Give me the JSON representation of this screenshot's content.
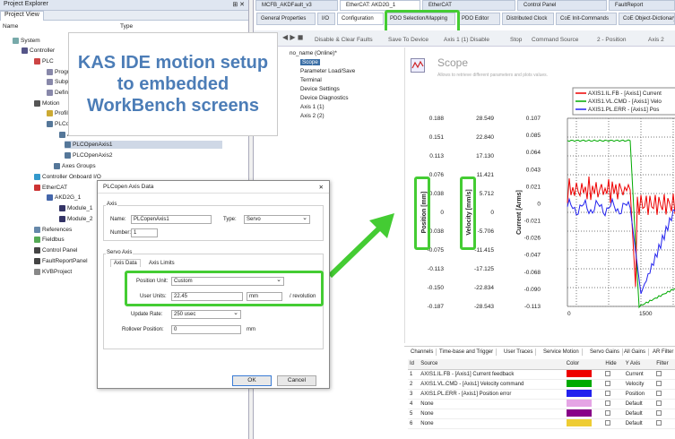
{
  "left_panel": {
    "title": "Project Explorer",
    "tab": "Project View",
    "col_name": "Name",
    "col_type": "Type",
    "tree": [
      "System",
      "Controller",
      "PLC",
      "Progr",
      "Subp",
      "Defin",
      "Motion",
      "Profil",
      "PLCo",
      "A",
      "PLCOpenAxis1",
      "PLCOpenAxis2",
      "Axes Groups",
      "Controller Onboard I/O",
      "EtherCAT",
      "AKD2G_1",
      "Module_1",
      "Module_2",
      "References",
      "Fieldbus",
      "Control Panel",
      "FaultReportPanel",
      "KVBProject"
    ]
  },
  "annotation": {
    "text": "KAS IDE motion setup to embedded WorkBench screens"
  },
  "dialog": {
    "title": "PLCopen Axis Data",
    "axis_group": "Axis",
    "name_label": "Name:",
    "name_value": "PLCopenAxis1",
    "type_label": "Type:",
    "type_value": "Servo",
    "number_label": "Number:",
    "number_value": "1",
    "servo_group": "Servo Axis",
    "tab_axis_data": "Axis Data",
    "tab_axis_limits": "Axis Limits",
    "position_unit_label": "Position Unit:",
    "position_unit_value": "Custom",
    "user_units_label": "User Units:",
    "user_units_value": "22.45",
    "user_units_unit": "mm",
    "per_revolution": "/ revolution",
    "update_rate_label": "Update Rate:",
    "update_rate_value": "250 usec",
    "rollover_label": "Rollover Position:",
    "rollover_value": "0",
    "rollover_unit": "mm",
    "ok": "OK",
    "cancel": "Cancel"
  },
  "right_panel": {
    "doc_tabs": [
      "MCFB_AKDFault_v3",
      "EtherCAT: AKD2G_1",
      "EtherCAT",
      "Control Panel",
      "FaultReport"
    ],
    "sub_tabs": [
      "General Properties",
      "I/O",
      "Configuration",
      "PDO Selection/Mapping",
      "PDO Editor",
      "Distributed Clock",
      "CoE Init-Commands",
      "CoE Object-Dictionary"
    ],
    "toolbar": [
      "Disable & Clear Faults",
      "Save To Device",
      "Axis 1 (1) Disable",
      "Stop",
      "Command Source",
      "2 - Position",
      "Axis 2"
    ],
    "nav_tree": [
      "no_name (Online)*",
      "Scope",
      "Parameter Load/Save",
      "Terminal",
      "Device Settings",
      "Device Diagnostics",
      "Axis 1 (1)",
      "Axis 2 (2)"
    ],
    "scope_title": "Scope",
    "scope_subtitle": "Allows to retrieve different parameters and plots values.",
    "bottom_tabs": [
      "Channels",
      "Time-base and Trigger",
      "User Traces",
      "Service Motion",
      "Servo Gains",
      "All Gains",
      "AR Filter"
    ],
    "table_headers": [
      "Id",
      "Source",
      "Color",
      "Hide",
      "Y Axis",
      "Filter"
    ],
    "channels": [
      {
        "id": "1",
        "source": "AXIS1.IL.FB - [Axis1] Current feedback",
        "color": "#ee0000",
        "yaxis": "Current"
      },
      {
        "id": "2",
        "source": "AXIS1.VL.CMD - [Axis1] Velocity command",
        "color": "#00aa00",
        "yaxis": "Velocity"
      },
      {
        "id": "3",
        "source": "AXIS1.PL.ERR - [Axis1] Position error",
        "color": "#2222ee",
        "yaxis": "Position"
      },
      {
        "id": "4",
        "source": "None",
        "color": "#e5a5e5",
        "yaxis": "Default"
      },
      {
        "id": "5",
        "source": "None",
        "color": "#880088",
        "yaxis": "Default"
      },
      {
        "id": "6",
        "source": "None",
        "color": "#eecc33",
        "yaxis": "Default"
      }
    ]
  },
  "chart_data": {
    "type": "line",
    "y_axes": [
      {
        "label": "Position [mm]",
        "ticks": [
          "0.188",
          "0.151",
          "0.113",
          "0.076",
          "0.038",
          "0",
          "-0.038",
          "-0.075",
          "-0.113",
          "-0.150",
          "-0.187"
        ]
      },
      {
        "label": "Velocity [mm/s]",
        "ticks": [
          "28.549",
          "22.840",
          "17.130",
          "11.421",
          "5.712",
          "0",
          "-5.706",
          "-11.415",
          "-17.125",
          "-22.834",
          "-28.543"
        ]
      },
      {
        "label": "Current [Arms]",
        "ticks": [
          "0.107",
          "0.085",
          "0.064",
          "0.043",
          "0.021",
          "0",
          "-0.021",
          "-0.026",
          "-0.047",
          "-0.068",
          "-0.090",
          "-0.113"
        ]
      }
    ],
    "x_ticks": [
      "0",
      "1500"
    ],
    "legend": [
      "AXIS1.IL.FB - [Axis1] Current",
      "AXIS1.VL.CMD - [Axis1] Velo",
      "AXIS1.PL.ERR - [Axis1] Pos"
    ],
    "series": [
      {
        "name": "AXIS1.IL.FB - [Axis1] Current",
        "color": "#ee0000"
      },
      {
        "name": "AXIS1.VL.CMD - [Axis1] Velo",
        "color": "#00aa00"
      },
      {
        "name": "AXIS1.PL.ERR - [Axis1] Pos",
        "color": "#2222ee"
      }
    ]
  }
}
